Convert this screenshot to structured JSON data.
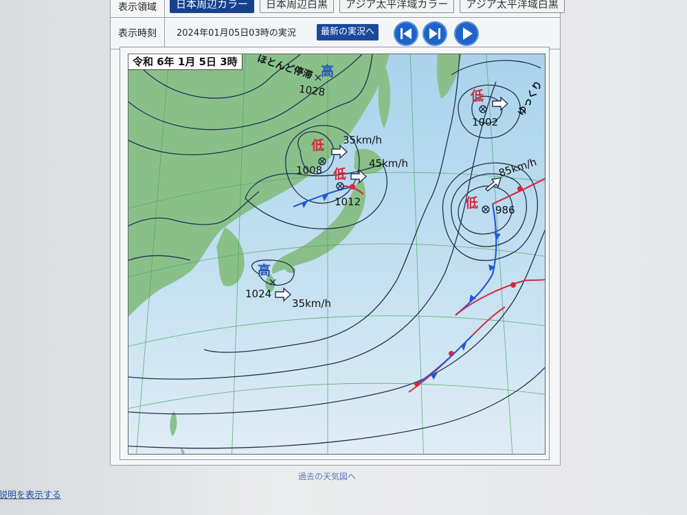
{
  "controls": {
    "area_label": "表示領域",
    "area_tabs": [
      {
        "label": "日本周辺カラー",
        "active": true
      },
      {
        "label": "日本周辺白黒",
        "active": false
      },
      {
        "label": "アジア太平洋域カラー",
        "active": false
      },
      {
        "label": "アジア太平洋域白黒",
        "active": false
      }
    ],
    "time_label": "表示時刻",
    "time_text": "2024年01月05日03時の実況",
    "latest_button": "最新の実況へ"
  },
  "map": {
    "date_label": "令和 6年 1月 5日 3時",
    "pressure_systems": [
      {
        "type": "高",
        "pressure": "1028",
        "note": "ほとんど停滞"
      },
      {
        "type": "低",
        "pressure": "1008",
        "speed": "35km/h"
      },
      {
        "type": "低",
        "pressure": "1012",
        "speed": "45km/h"
      },
      {
        "type": "低",
        "pressure": "1002",
        "note": "ゆっくり"
      },
      {
        "type": "低",
        "pressure": "986",
        "speed": "85km/h"
      },
      {
        "type": "高",
        "pressure": "1024",
        "speed": "35km/h"
      }
    ],
    "colors": {
      "land": "#89c08a",
      "sea": "#b7dcef",
      "sea_south": "#d9eaf5",
      "isobar": "#1f2e4a",
      "cold_front": "#2458d8",
      "warm_front": "#d8283a",
      "high": "#2451b8",
      "low": "#d8283a"
    }
  },
  "footer": {
    "past_link": "過去の天気図へ",
    "explain_link": "説明を表示する"
  }
}
